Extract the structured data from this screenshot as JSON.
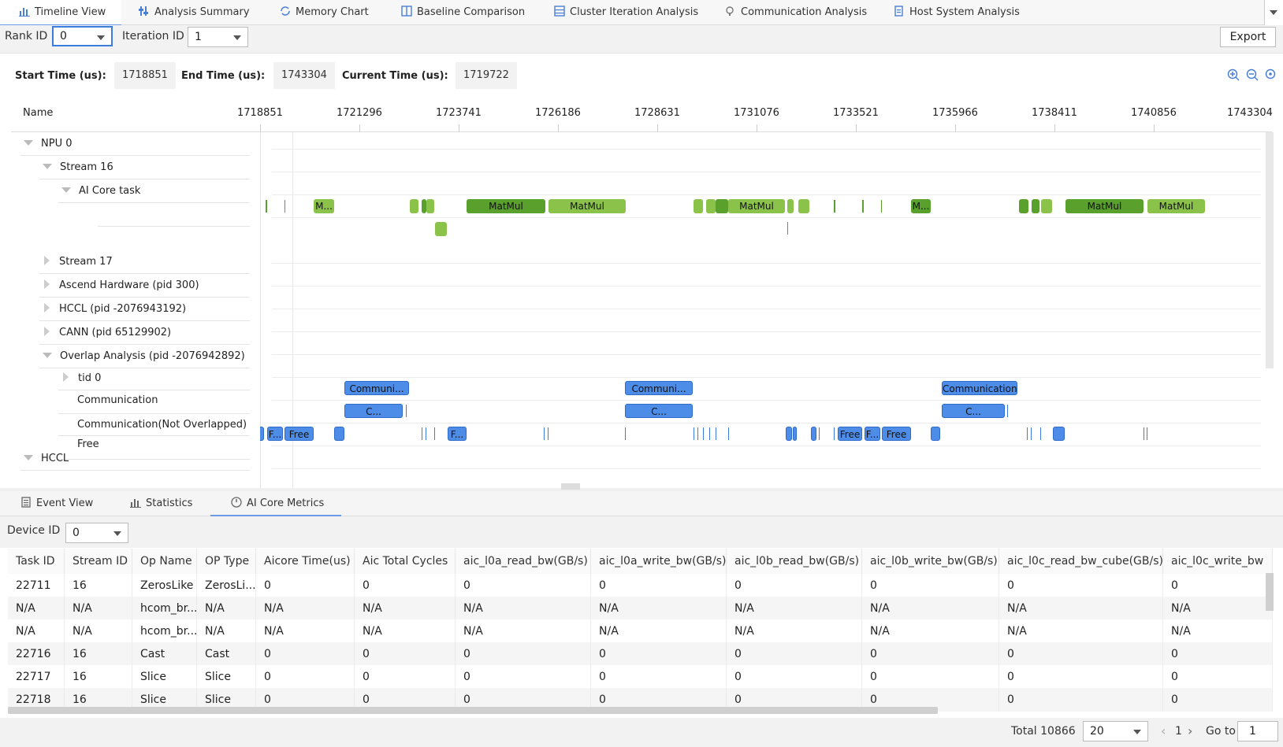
{
  "top_tabs": [
    {
      "label": "Timeline View",
      "icon": "bar-chart-icon"
    },
    {
      "label": "Analysis Summary",
      "icon": "sliders-icon"
    },
    {
      "label": "Memory Chart",
      "icon": "refresh-icon"
    },
    {
      "label": "Baseline Comparison",
      "icon": "compare-icon"
    },
    {
      "label": "Cluster Iteration Analysis",
      "icon": "grid-icon"
    },
    {
      "label": "Communication Analysis",
      "icon": "network-icon"
    },
    {
      "label": "Host System Analysis",
      "icon": "document-icon"
    }
  ],
  "controls": {
    "rank_label": "Rank ID",
    "rank_value": "0",
    "iteration_label": "Iteration ID",
    "iteration_value": "1",
    "export_label": "Export"
  },
  "times": {
    "start_label": "Start Time (us):",
    "start_value": "1718851",
    "end_label": "End Time (us):",
    "end_value": "1743304",
    "current_label": "Current Time (us):",
    "current_value": "1719722"
  },
  "timeline": {
    "name_header": "Name",
    "ticks": [
      "1718851",
      "1721296",
      "1723741",
      "1726186",
      "1728631",
      "1731076",
      "1733521",
      "1735966",
      "1738411",
      "1740856",
      "1743304"
    ],
    "tree": [
      "NPU 0",
      "Stream 16",
      "AI Core task",
      "Stream 17",
      "Ascend Hardware (pid 300)",
      "HCCL (pid -2076943192)",
      "CANN (pid 65129902)",
      "Overlap Analysis (pid -2076942892)",
      "tid 0",
      "Communication",
      "Communication(Not Overlapped)",
      "Free",
      "HCCL"
    ],
    "ai_core_bars": [
      "M...",
      "MatMul",
      "MatMul",
      "MatMul",
      "M...",
      "MatMul",
      "MatMul"
    ],
    "comm_bars": [
      "Communi...",
      "Communi...",
      "Communication"
    ],
    "comm_no_bars": [
      "C...",
      "C...",
      "C..."
    ],
    "free_bars": [
      "F...",
      "Free",
      "F...",
      "Free",
      "F...",
      "Free"
    ]
  },
  "bottom_tabs": [
    {
      "label": "Event View",
      "icon": "list-icon"
    },
    {
      "label": "Statistics",
      "icon": "bar-chart-icon"
    },
    {
      "label": "AI Core Metrics",
      "icon": "gauge-icon"
    }
  ],
  "device": {
    "label": "Device ID",
    "value": "0"
  },
  "table": {
    "headers": [
      "Task ID",
      "Stream ID",
      "Op Name",
      "OP Type",
      "Aicore Time(us)",
      "Aic Total Cycles",
      "aic_l0a_read_bw(GB/s)",
      "aic_l0a_write_bw(GB/s)",
      "aic_l0b_read_bw(GB/s)",
      "aic_l0b_write_bw(GB/s)",
      "aic_l0c_read_bw_cube(GB/s)",
      "aic_l0c_write_bw"
    ],
    "rows": [
      [
        "22711",
        "16",
        "ZerosLike",
        "ZerosLi...",
        "0",
        "0",
        "0",
        "0",
        "0",
        "0",
        "0",
        "0"
      ],
      [
        "N/A",
        "N/A",
        "hcom_br...",
        "N/A",
        "N/A",
        "N/A",
        "N/A",
        "N/A",
        "N/A",
        "N/A",
        "N/A",
        "N/A"
      ],
      [
        "N/A",
        "N/A",
        "hcom_br...",
        "N/A",
        "N/A",
        "N/A",
        "N/A",
        "N/A",
        "N/A",
        "N/A",
        "N/A",
        "N/A"
      ],
      [
        "22716",
        "16",
        "Cast",
        "Cast",
        "0",
        "0",
        "0",
        "0",
        "0",
        "0",
        "0",
        "0"
      ],
      [
        "22717",
        "16",
        "Slice",
        "Slice",
        "0",
        "0",
        "0",
        "0",
        "0",
        "0",
        "0",
        "0"
      ],
      [
        "22718",
        "16",
        "Slice",
        "Slice",
        "0",
        "0",
        "0",
        "0",
        "0",
        "0",
        "0",
        "0"
      ]
    ]
  },
  "pagination": {
    "total": "Total 10866",
    "page_size": "20",
    "prev": "‹",
    "page": "1",
    "next": "›",
    "goto_label": "Go to",
    "goto_value": "1"
  }
}
